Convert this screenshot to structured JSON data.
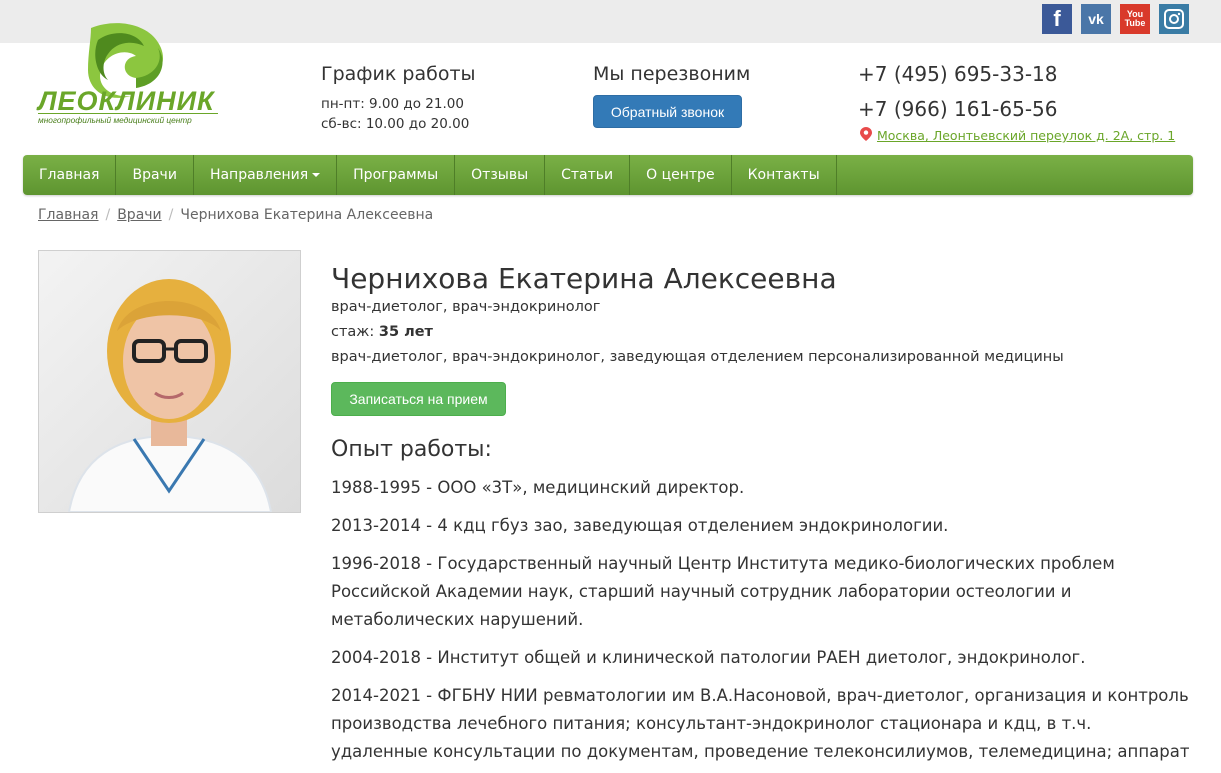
{
  "social": {
    "fb": "f",
    "vk": "vk",
    "yt_top": "You",
    "yt_bottom": "Tube"
  },
  "logo": {
    "name": "ЛЕОКЛИНИК",
    "tagline": "многопрофильный медицинский центр"
  },
  "schedule": {
    "title": "График работы",
    "weekdays": "пн-пт: 9.00 до 21.00",
    "weekend": "сб-вс: 10.00 до 20.00"
  },
  "callback": {
    "title": "Мы перезвоним",
    "button": "Обратный звонок"
  },
  "contacts": {
    "phone1": "+7 (495) 695-33-18",
    "phone2": "+7 (966) 161-65-56",
    "address": "Москва, Леонтьевский переулок д. 2А, стр. 1"
  },
  "nav": [
    "Главная",
    "Врачи",
    "Направления",
    "Программы",
    "Отзывы",
    "Статьи",
    "О центре",
    "Контакты"
  ],
  "breadcrumb": {
    "home": "Главная",
    "doctors": "Врачи",
    "current": "Чернихова Екатерина Алексеевна"
  },
  "doctor": {
    "name": "Чернихова Екатерина Алексеевна",
    "specialty": "врач-диетолог, врач-эндокринолог",
    "experience_label": "стаж:",
    "experience_value": "35 лет",
    "position": "врач-диетолог, врач-эндокринолог, заведующая отделением персонализированной медицины",
    "book_button": "Записаться на прием"
  },
  "experience": {
    "title": "Опыт работы:",
    "items": [
      "1988-1995 - ООО «3Т», медицинский директор.",
      "2013-2014 - 4 кдц гбуз зао, заведующая отделением эндокринологии.",
      "1996-2018 - Государственный научный Центр Института медико-биологических проблем Российской Академии наук, старший научный сотрудник лаборатории остеологии и метаболических нарушений.",
      "2004-2018 - Институт общей и клинической патологии РАЕН диетолог, эндокринолог.",
      "2014-2021 - ФГБНУ НИИ ревматологии им В.А.Насоновой, врач-диетолог, организация и контроль производства лечебного питания; консультант-эндокринолог стационара и кдц, в т.ч. удаленные консультации по документам, проведение телеконсилиумов, телемедицина; аппарат"
    ]
  }
}
